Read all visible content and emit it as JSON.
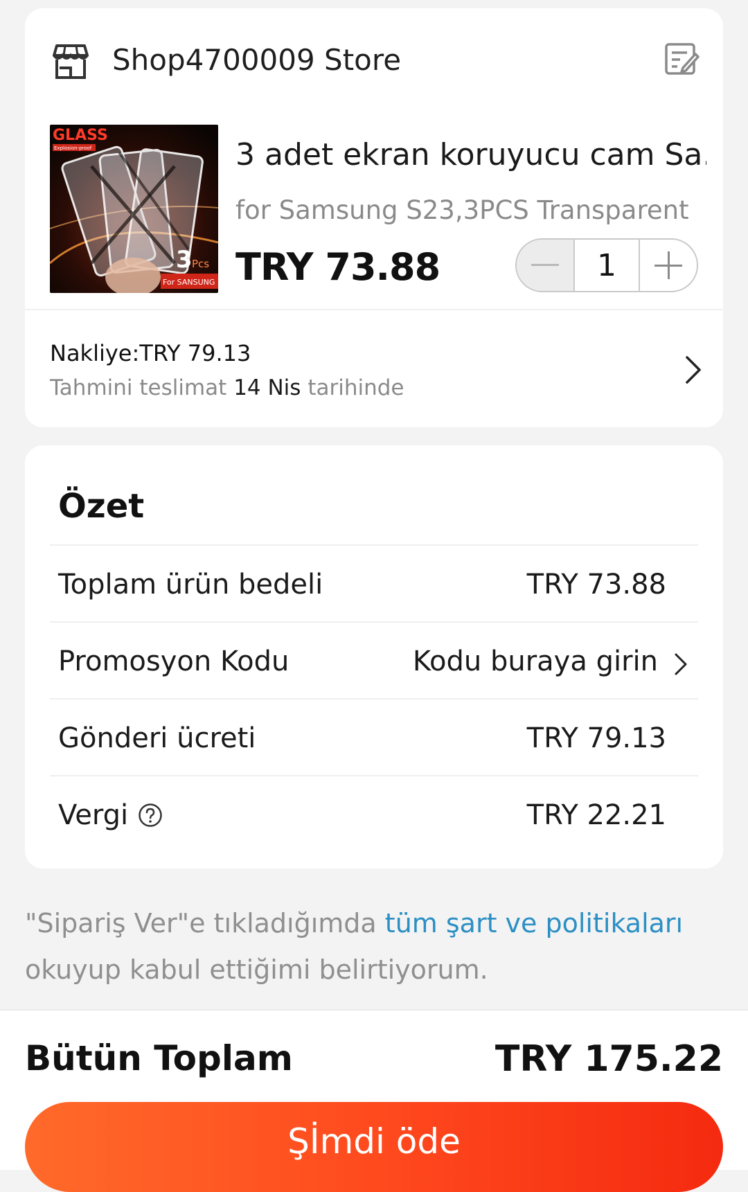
{
  "store": {
    "name": "Shop4700009 Store",
    "icons": {
      "store": "store-icon",
      "note": "note-edit-icon"
    }
  },
  "product": {
    "image_text": {
      "brand": "GLASS",
      "sub": "Explosion-proof",
      "count": "3",
      "unit": "Pcs",
      "model": "For SANSUNG"
    },
    "title": "3 adet ekran koruyucu cam Sa...",
    "variant": "for Samsung S23,3PCS Transparent",
    "price": "TRY 73.88",
    "quantity": "1"
  },
  "shipping": {
    "label": "Nakliye:TRY 79.13",
    "eta_prefix": "Tahmini teslimat",
    "eta_date": "14 Nis",
    "eta_suffix": "tarihinde"
  },
  "summary": {
    "title": "Özet",
    "rows": [
      {
        "label": "Toplam ürün bedeli",
        "value": "TRY 73.88"
      },
      {
        "label": "Promosyon Kodu",
        "value": "Kodu buraya girin"
      },
      {
        "label": "Gönderi ücreti",
        "value": "TRY 79.13"
      },
      {
        "label": "Vergi",
        "value": "TRY 22.21"
      }
    ]
  },
  "terms": {
    "prefix": "\"Sipariş Ver\"e tıkladığımda",
    "link": "tüm şart ve politikaları",
    "suffix": "okuyup kabul ettiğimi belirtiyorum."
  },
  "footer": {
    "total_label": "Bütün Toplam",
    "total_value": "TRY 175.22",
    "pay_label": "Şİmdi öde"
  },
  "colors": {
    "accent_start": "#ff6a2a",
    "accent_end": "#f52a10",
    "link": "#2b8fc4",
    "muted": "#8a8a8a"
  }
}
